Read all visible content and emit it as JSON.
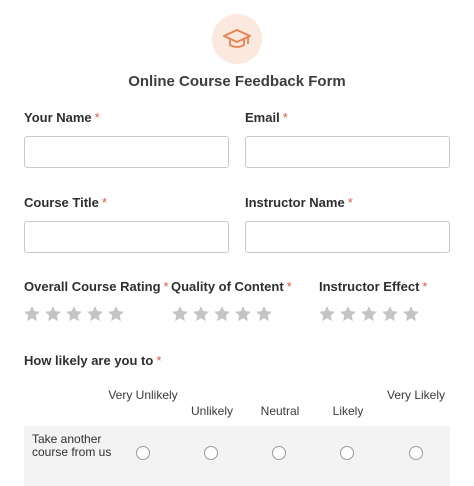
{
  "form": {
    "title": "Online Course Feedback Form",
    "logo_icon": "graduation-cap-icon",
    "accent_color": "#e8824f",
    "required_mark": "*"
  },
  "fields": {
    "name": {
      "label": "Your Name",
      "value": ""
    },
    "email": {
      "label": "Email",
      "value": ""
    },
    "course_title": {
      "label": "Course Title",
      "value": ""
    },
    "instructor_name": {
      "label": "Instructor Name",
      "value": ""
    }
  },
  "ratings": [
    {
      "label": "Overall Course Rating",
      "stars": 5,
      "value": 0
    },
    {
      "label": "Quality of Content",
      "stars": 5,
      "value": 0
    },
    {
      "label": "Instructor Effect",
      "stars": 5,
      "value": 0
    }
  ],
  "likert": {
    "question": "How likely are you to",
    "columns": [
      "Very Unlikely",
      "Unlikely",
      "Neutral",
      "Likely",
      "Very Likely"
    ],
    "rows": [
      {
        "label": "Take another course from us",
        "selected": null
      }
    ]
  }
}
